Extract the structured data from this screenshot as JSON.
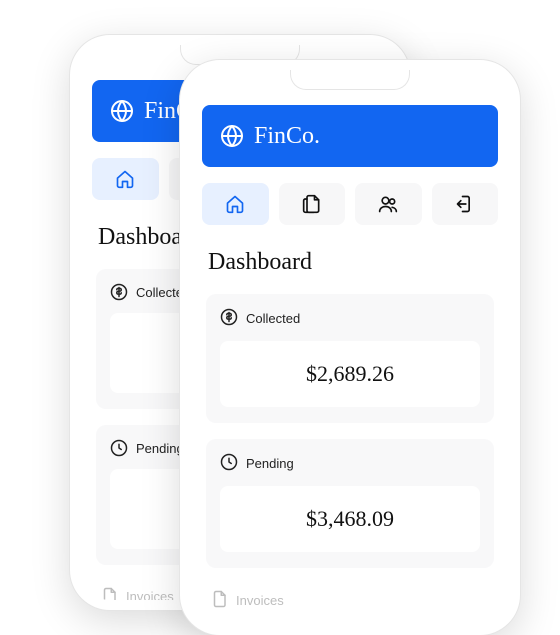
{
  "brand": "FinCo.",
  "colors": {
    "primary": "#1266f1",
    "tab_active_bg": "#e7f0ff"
  },
  "nav": {
    "items": [
      {
        "name": "home",
        "active": true
      },
      {
        "name": "documents",
        "active": false
      },
      {
        "name": "users",
        "active": false
      },
      {
        "name": "logout",
        "active": false
      }
    ]
  },
  "page_title": "Dashboard",
  "cards": {
    "collected": {
      "label": "Collected",
      "value": "$2,689.26"
    },
    "pending": {
      "label": "Pending",
      "value": "$3,468.09"
    }
  },
  "sections": {
    "invoices": {
      "label": "Invoices"
    }
  }
}
